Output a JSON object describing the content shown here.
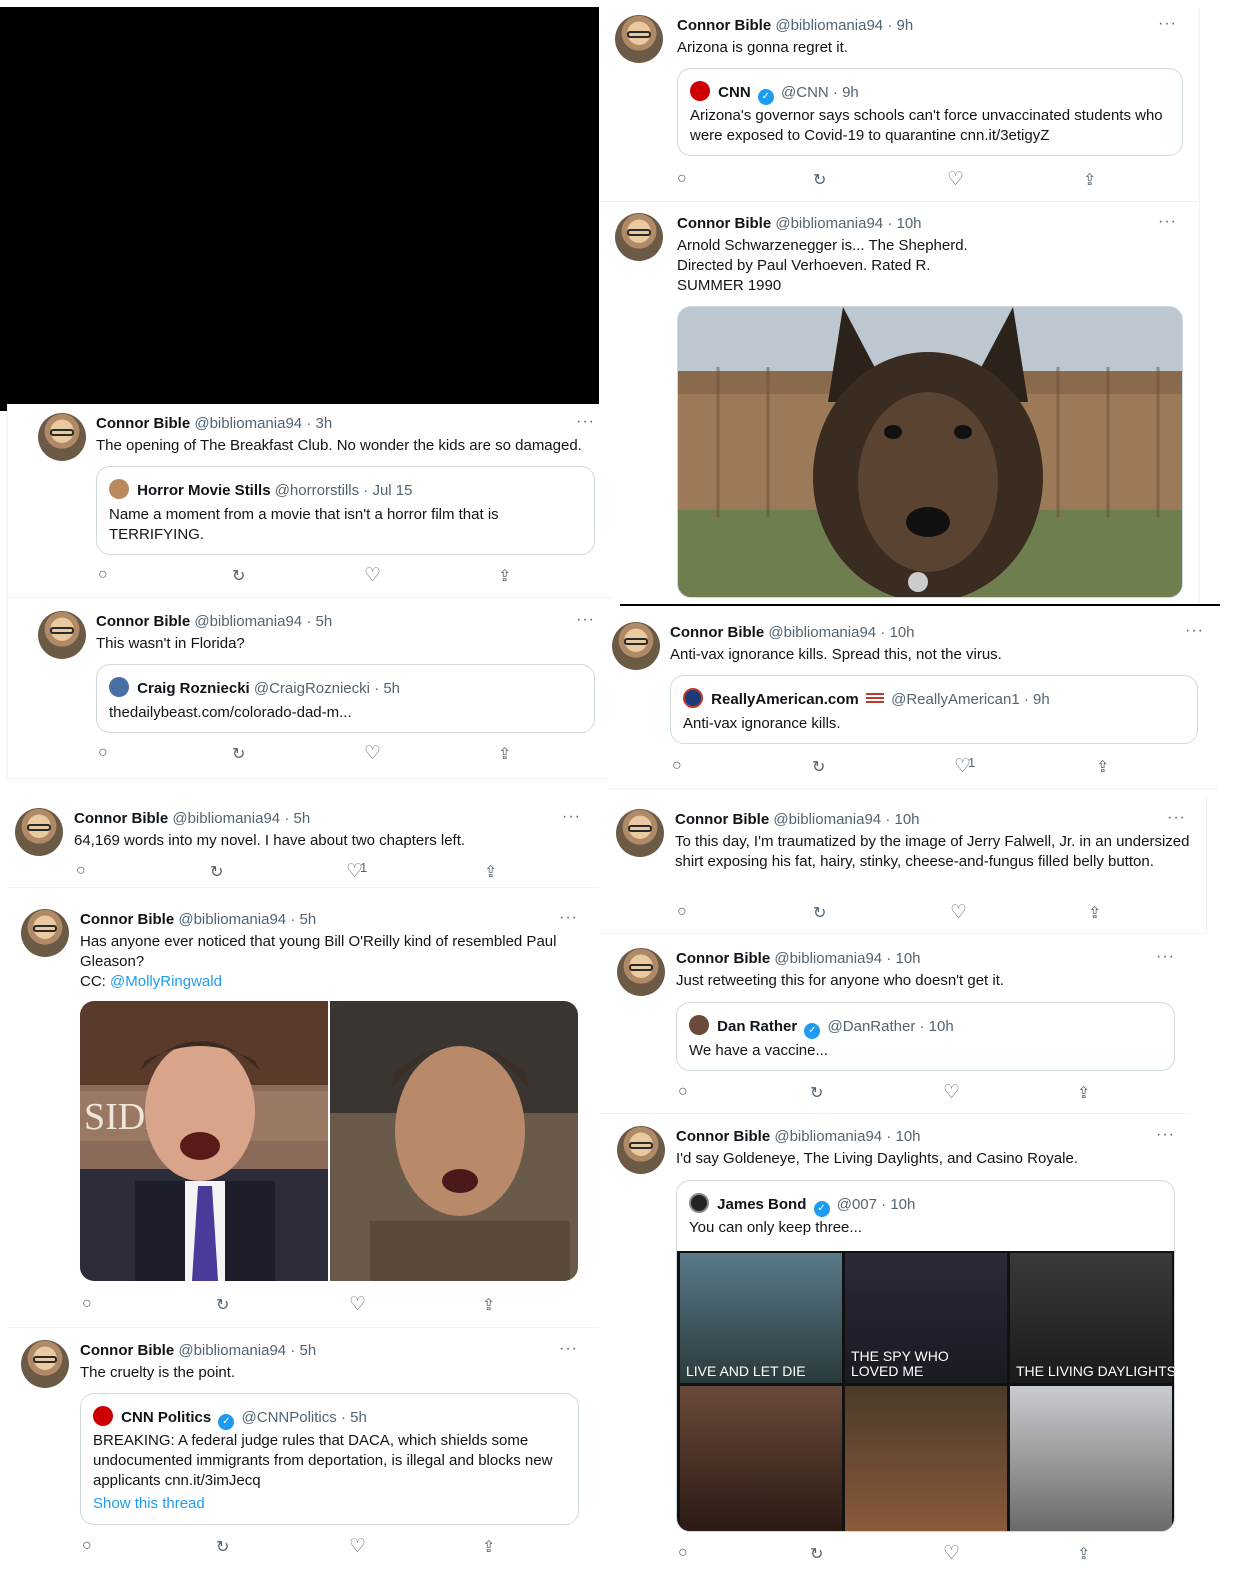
{
  "user": {
    "name": "Connor Bible",
    "handle": "@bibliomania94"
  },
  "tweets": {
    "t1": {
      "time": "9h",
      "text": "Arizona is gonna regret it.",
      "quote": {
        "name": "CNN",
        "handle": "@CNN",
        "time": "9h",
        "text": "Arizona's governor says schools can't force unvaccinated students who were exposed to Covid-19 to quarantine cnn.it/3etigyZ"
      }
    },
    "t2": {
      "time": "10h",
      "line1": "Arnold Schwarzenegger is... The Shepherd.",
      "line2": "Directed by Paul Verhoeven. Rated R.",
      "line3": "SUMMER 1990"
    },
    "t3": {
      "time": "3h",
      "text": "The opening of The Breakfast Club. No wonder the kids are so damaged.",
      "quote": {
        "name": "Horror Movie Stills",
        "handle": "@horrorstills",
        "time": "Jul 15",
        "text": "Name a moment from a movie that isn't a horror film that is TERRIFYING."
      }
    },
    "t4": {
      "time": "5h",
      "text": "This wasn't in Florida?",
      "quote": {
        "name": "Craig Rozniecki",
        "handle": "@CraigRozniecki",
        "time": "5h",
        "text": "thedailybeast.com/colorado-dad-m..."
      }
    },
    "t5": {
      "time": "10h",
      "text": "Anti-vax ignorance kills. Spread this, not the virus.",
      "likes": "1",
      "quote": {
        "name": "ReallyAmerican.com",
        "handle": "@ReallyAmerican1",
        "time": "9h",
        "text": "Anti-vax ignorance kills."
      }
    },
    "t6": {
      "time": "5h",
      "text": "64,169 words into my novel. I have about two chapters left.",
      "likes": "1"
    },
    "t7": {
      "time": "10h",
      "text": "To this day, I'm traumatized by the image of Jerry Falwell, Jr. in an undersized shirt exposing his fat, hairy, stinky, cheese-and-fungus filled belly button."
    },
    "t8": {
      "time": "5h",
      "text": "Has anyone ever noticed that young Bill O'Reilly kind of resembled Paul Gleason?",
      "cc": "CC:",
      "mention": "@MollyRingwald",
      "img_left_text": "SIDE ON"
    },
    "t9": {
      "time": "10h",
      "text": "Just retweeting this for anyone who doesn't get it.",
      "quote": {
        "name": "Dan Rather",
        "handle": "@DanRather",
        "time": "10h",
        "text": "We have a vaccine..."
      }
    },
    "t10": {
      "time": "5h",
      "text": "The cruelty is the point.",
      "quote": {
        "name": "CNN Politics",
        "handle": "@CNNPolitics",
        "time": "5h",
        "text": "BREAKING: A federal judge rules that DACA, which shields some undocumented immigrants from deportation, is illegal and blocks new applicants cnn.it/3imJecq",
        "thread": "Show this thread"
      }
    },
    "t11": {
      "time": "10h",
      "text": "I'd say Goldeneye, The Living Daylights, and Casino Royale.",
      "quote": {
        "name": "James Bond",
        "handle": "@007",
        "time": "10h",
        "text": "You can only keep three...",
        "tiles": [
          "LIVE AND LET DIE",
          "THE SPY WHO LOVED ME",
          "THE LIVING DAYLIGHTS",
          "",
          "",
          ""
        ]
      }
    }
  },
  "dot_sep": "·",
  "more": "···",
  "colors": {
    "accent": "#1d9bf0",
    "muted": "#536471",
    "border": "#cfd9de"
  }
}
